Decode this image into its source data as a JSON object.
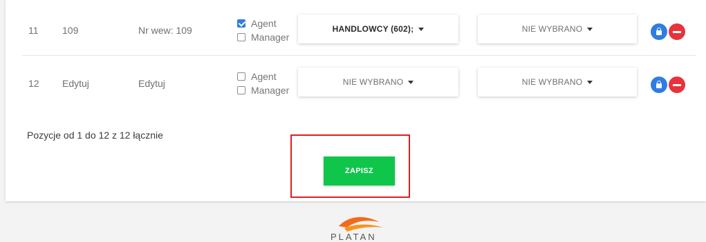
{
  "rows": [
    {
      "lp": "11",
      "extension": "109",
      "name": "Nr wew: 109",
      "roles": [
        {
          "label": "Agent",
          "checked": true
        },
        {
          "label": "Manager",
          "checked": false
        }
      ],
      "group_dropdown": "HANDLOWCY (602);",
      "second_dropdown": "NIE WYBRANO"
    },
    {
      "lp": "12",
      "extension": "Edytuj",
      "name": "Edytuj",
      "roles": [
        {
          "label": "Agent",
          "checked": false
        },
        {
          "label": "Manager",
          "checked": false
        }
      ],
      "group_dropdown": "NIE WYBRANO",
      "second_dropdown": "NIE WYBRANO"
    }
  ],
  "pagination_info": "Pozycje od 1 do 12 z 12 łącznie",
  "save_label": "ZAPISZ",
  "logo_text": "PLATAN",
  "colors": {
    "accent_blue": "#2f7de1",
    "danger_red": "#e8323c",
    "save_green": "#0fc64a",
    "highlight_red": "#e11d1d"
  },
  "icons": [
    "lock-icon",
    "remove-icon",
    "chevron-down-icon"
  ]
}
